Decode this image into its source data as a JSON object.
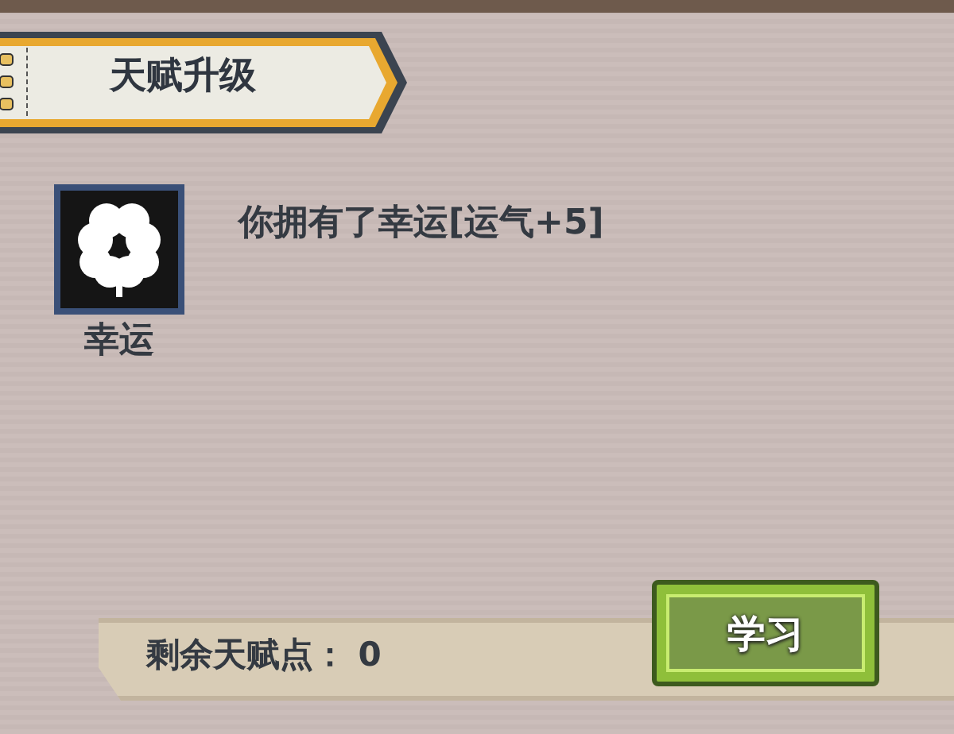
{
  "title": "天赋升级",
  "talent": {
    "name": "幸运",
    "description": "你拥有了幸运[运气+5]"
  },
  "remaining_points": {
    "label": "剩余天赋点：",
    "value": "0"
  },
  "buttons": [
    {
      "label": "学习"
    }
  ]
}
